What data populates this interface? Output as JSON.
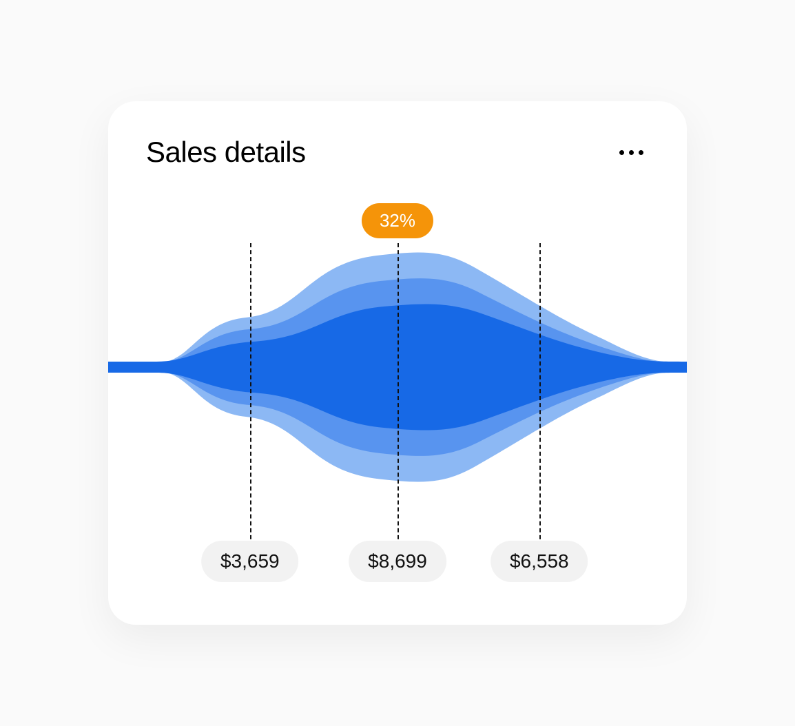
{
  "card": {
    "title": "Sales details",
    "percent_badge": "32%",
    "points": [
      {
        "x_pct": 24.5,
        "value_label": "$3,659",
        "value": 3659
      },
      {
        "x_pct": 50.0,
        "value_label": "$8,699",
        "value": 8699
      },
      {
        "x_pct": 74.5,
        "value_label": "$6,558",
        "value": 6558
      }
    ]
  },
  "colors": {
    "accent": "#F59409",
    "stream_dark": "#1769E6",
    "stream_mid": "#5894EF",
    "stream_light": "#8CB8F4",
    "pill_bg": "#F2F2F2"
  },
  "chart_data": {
    "type": "area",
    "title": "Sales details",
    "annotations": [
      {
        "label": "32%",
        "x": 50
      }
    ],
    "series": [
      {
        "name": "layer-outer",
        "color": "#8CB8F4"
      },
      {
        "name": "layer-mid",
        "color": "#5894EF"
      },
      {
        "name": "layer-inner",
        "color": "#1769E6"
      }
    ],
    "x": [
      24.5,
      50.0,
      74.5
    ],
    "values": [
      3659,
      8699,
      6558
    ],
    "value_labels": [
      "$3,659",
      "$8,699",
      "$6,558"
    ],
    "xlabel": "",
    "ylabel": ""
  }
}
